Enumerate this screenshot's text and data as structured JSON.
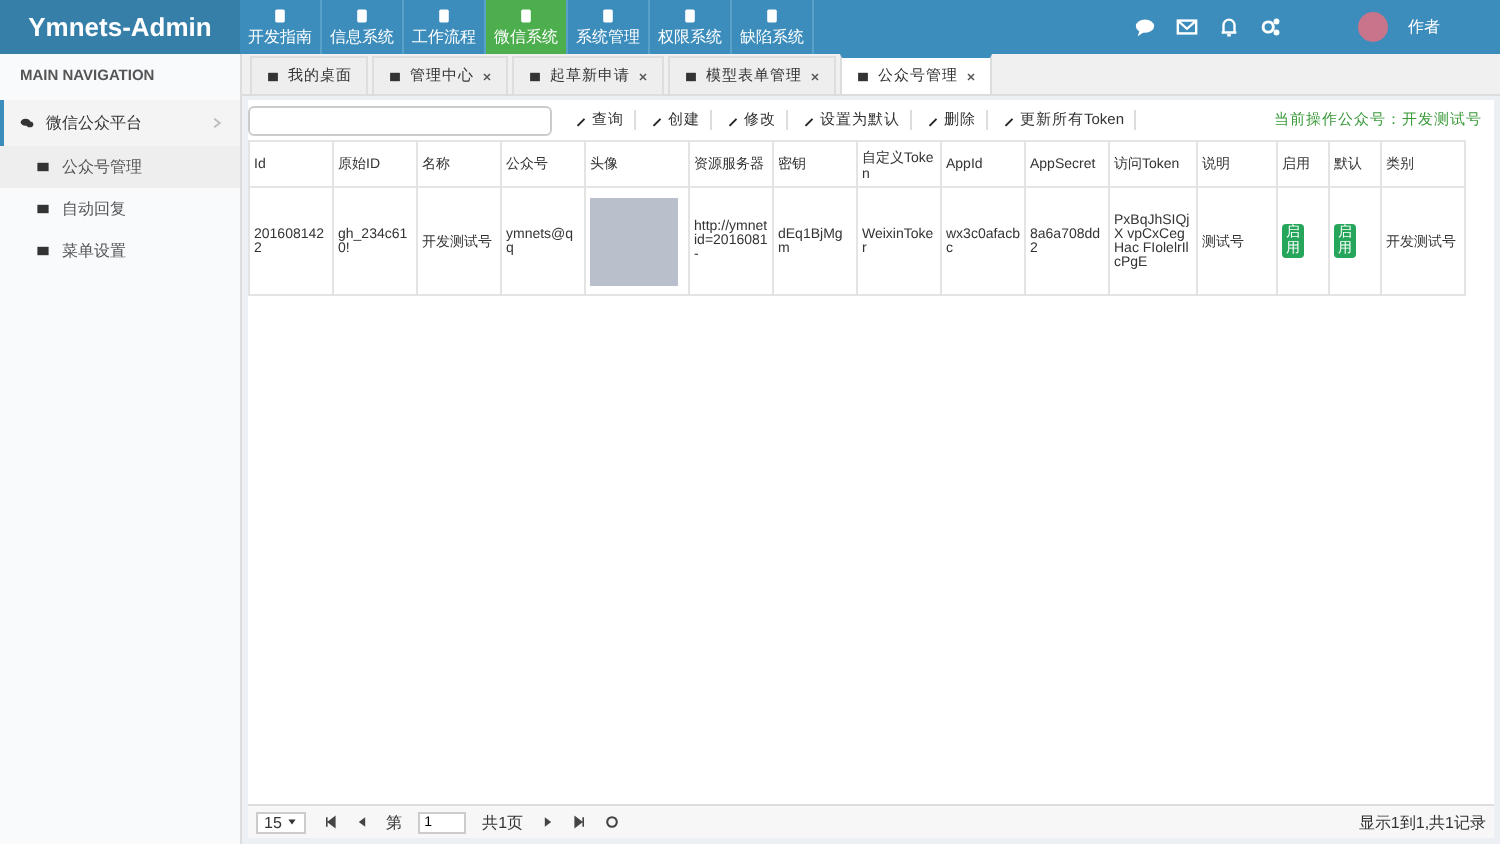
{
  "brand": "Ymnets-Admin",
  "top_menu": [
    {
      "label": "开发指南",
      "selected": false
    },
    {
      "label": "信息系统",
      "selected": false
    },
    {
      "label": "工作流程",
      "selected": false
    },
    {
      "label": "微信系统",
      "selected": true
    },
    {
      "label": "系统管理",
      "selected": false
    },
    {
      "label": "权限系统",
      "selected": false
    },
    {
      "label": "缺陷系统",
      "selected": false
    }
  ],
  "user": {
    "name": "作者"
  },
  "sidebar": {
    "heading": "MAIN NAVIGATION",
    "groups": [
      {
        "label": "微信公众平台",
        "expanded": true,
        "children": [
          {
            "label": "公众号管理",
            "selected": true
          },
          {
            "label": "自动回复",
            "selected": false
          },
          {
            "label": "菜单设置",
            "selected": false
          }
        ]
      }
    ]
  },
  "tabs": [
    {
      "label": "我的桌面",
      "selected": false,
      "closable": false
    },
    {
      "label": "管理中心",
      "selected": false,
      "closable": true
    },
    {
      "label": "起草新申请",
      "selected": false,
      "closable": true
    },
    {
      "label": "模型表单管理",
      "selected": false,
      "closable": true
    },
    {
      "label": "公众号管理",
      "selected": true,
      "closable": true
    }
  ],
  "toolbar": {
    "buttons": [
      "查询",
      "创建",
      "修改",
      "设置为默认",
      "删除",
      "更新所有Token"
    ],
    "current_account": "当前操作公众号：开发测试号"
  },
  "table": {
    "columns": [
      "Id",
      "原始ID",
      "名称",
      "公众号",
      "头像",
      "资源服务器",
      "密钥",
      "自定义Token",
      "AppId",
      "AppSecret",
      "访问Token",
      "说明",
      "启用",
      "默认",
      "类别"
    ],
    "rows": [
      {
        "cells": [
          "2016081422",
          "gh_234c610!",
          "开发测试号",
          "ymnets@qq",
          null,
          "http://ymnet id=2016081-",
          "dEq1BjMgm",
          "WeixinToker",
          "wx3c0afacbc",
          "8a6a708dd2",
          "PxBqJhSIQjX vpCxCegHac FIolelrIlcPgE",
          "测试号",
          "启用",
          "启用",
          "开发测试号"
        ]
      }
    ]
  },
  "pager": {
    "page_size": "15",
    "page_label": "第",
    "page": "1",
    "total_pages": "共1页",
    "summary": "显示1到1,共1记录"
  }
}
